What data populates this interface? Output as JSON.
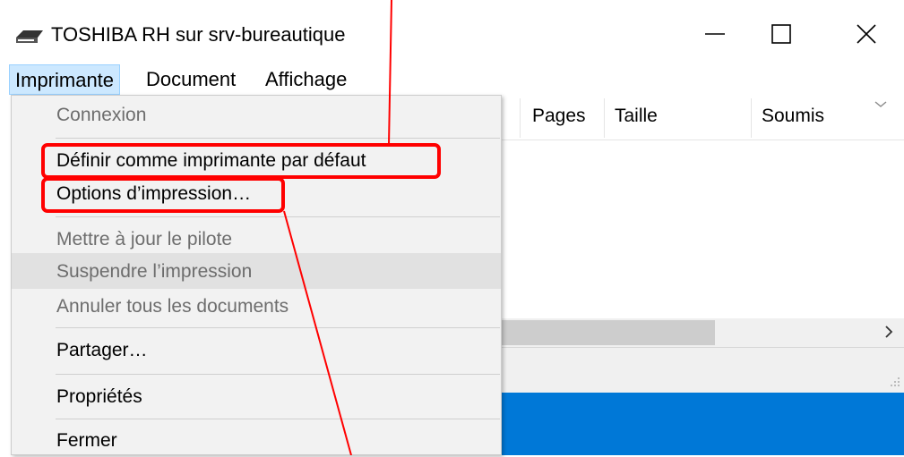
{
  "window": {
    "title": "TOSHIBA RH sur srv-bureautique",
    "app_icon": "printer-icon",
    "controls": [
      "minimize-icon",
      "maximize-icon",
      "close-icon"
    ]
  },
  "menubar": {
    "items": [
      {
        "label": "Imprimante",
        "active": true
      },
      {
        "label": "Document"
      },
      {
        "label": "Affichage"
      }
    ]
  },
  "columns": [
    "Pages",
    "Taille",
    "Soumis"
  ],
  "dropdown": {
    "items": [
      {
        "label": "Connexion",
        "enabled": false
      },
      {
        "label": "Définir comme imprimante par défaut",
        "enabled": true,
        "highlighted": true
      },
      {
        "label": "Options d’impression…",
        "enabled": true,
        "highlighted": true
      },
      {
        "label": "Mettre à jour le pilote",
        "enabled": false
      },
      {
        "label": "Suspendre l’impression",
        "enabled": false,
        "hovered": true
      },
      {
        "label": "Annuler tous les documents",
        "enabled": false
      },
      {
        "label": "Partager…",
        "enabled": true
      },
      {
        "label": "Propriétés",
        "enabled": true
      },
      {
        "label": "Fermer",
        "enabled": true
      }
    ]
  },
  "colors": {
    "annotation": "#ff0000",
    "menu_active": "#cce8ff",
    "accent_blue": "#0078d7"
  }
}
